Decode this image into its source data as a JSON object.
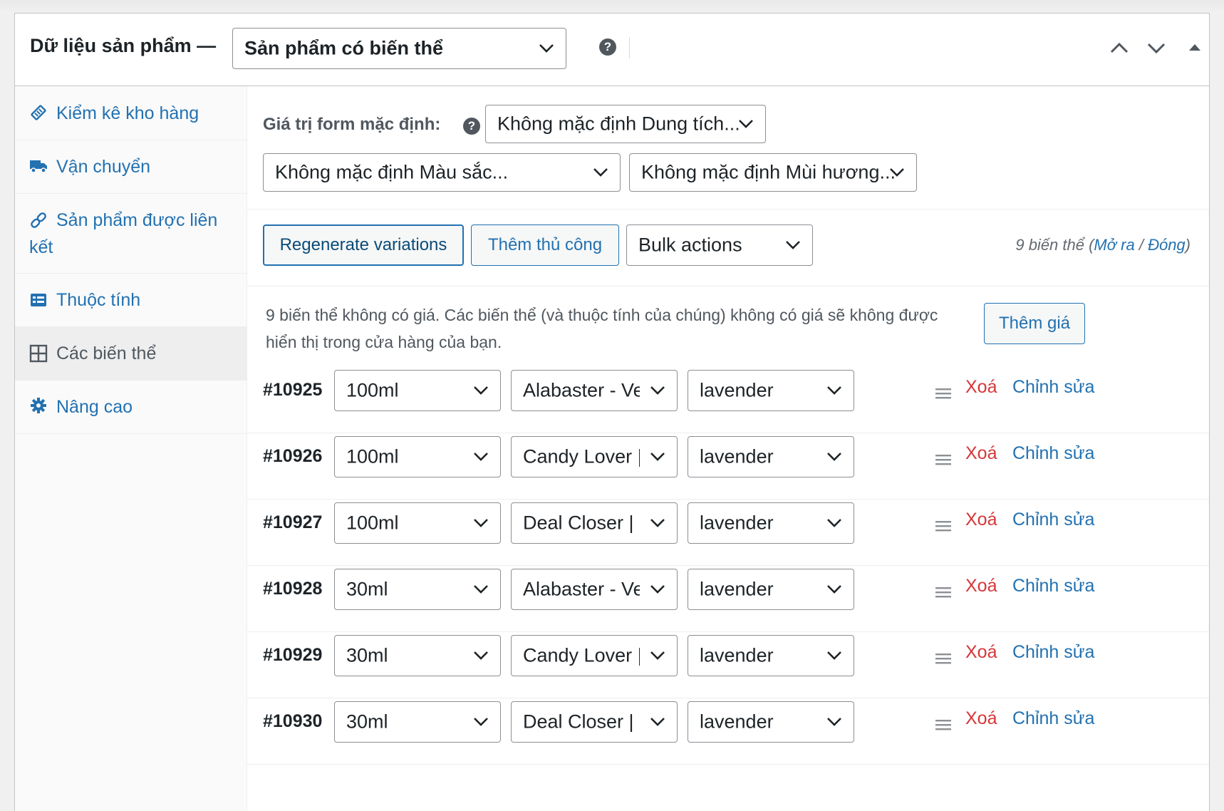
{
  "header": {
    "title": "Dữ liệu sản phẩm —",
    "product_type": "Sản phẩm có biến thể",
    "help": "?"
  },
  "sidebar": {
    "items": [
      {
        "label": "Kiểm kê kho hàng",
        "icon": "inventory-tag-icon"
      },
      {
        "label": "Vận chuyển",
        "icon": "truck-icon"
      },
      {
        "label": "Sản phẩm được liên kết",
        "icon": "link-icon"
      },
      {
        "label": "Thuộc tính",
        "icon": "list-card-icon"
      },
      {
        "label": "Các biến thể",
        "icon": "grid-icon"
      },
      {
        "label": "Nâng cao",
        "icon": "gear-icon"
      }
    ]
  },
  "defaults": {
    "label": "Giá trị form mặc định:",
    "help": "?",
    "capacity": "Không mặc định Dung tích...",
    "color": "Không mặc định Màu sắc...",
    "scent": "Không mặc định Mùi hương..."
  },
  "toolbar": {
    "regenerate": "Regenerate variations",
    "add_manual": "Thêm thủ công",
    "bulk_actions": "Bulk actions",
    "count_prefix": "9 biến thể (",
    "expand": "Mở ra",
    "slash": " / ",
    "collapse": "Đóng",
    "count_suffix": ")"
  },
  "notice": {
    "text": "9 biến thể không có giá. Các biến thể (và thuộc tính của chúng) không có giá sẽ không được hiển thị trong cửa hàng của bạn.",
    "add_price": "Thêm giá"
  },
  "actions": {
    "delete": "Xoá",
    "edit": "Chỉnh sửa"
  },
  "variations": [
    {
      "id": "#10925",
      "capacity": "100ml",
      "color": "Alabaster - Very",
      "scent": "lavender"
    },
    {
      "id": "#10926",
      "capacity": "100ml",
      "color": "Candy Lover | P",
      "scent": "lavender"
    },
    {
      "id": "#10927",
      "capacity": "100ml",
      "color": "Deal Closer | M",
      "scent": "lavender"
    },
    {
      "id": "#10928",
      "capacity": "30ml",
      "color": "Alabaster - Very",
      "scent": "lavender"
    },
    {
      "id": "#10929",
      "capacity": "30ml",
      "color": "Candy Lover | P",
      "scent": "lavender"
    },
    {
      "id": "#10930",
      "capacity": "30ml",
      "color": "Deal Closer | M",
      "scent": "lavender"
    }
  ],
  "colors": {
    "link": "#2271b1",
    "delete": "#d63638",
    "border": "#8c8f94"
  }
}
